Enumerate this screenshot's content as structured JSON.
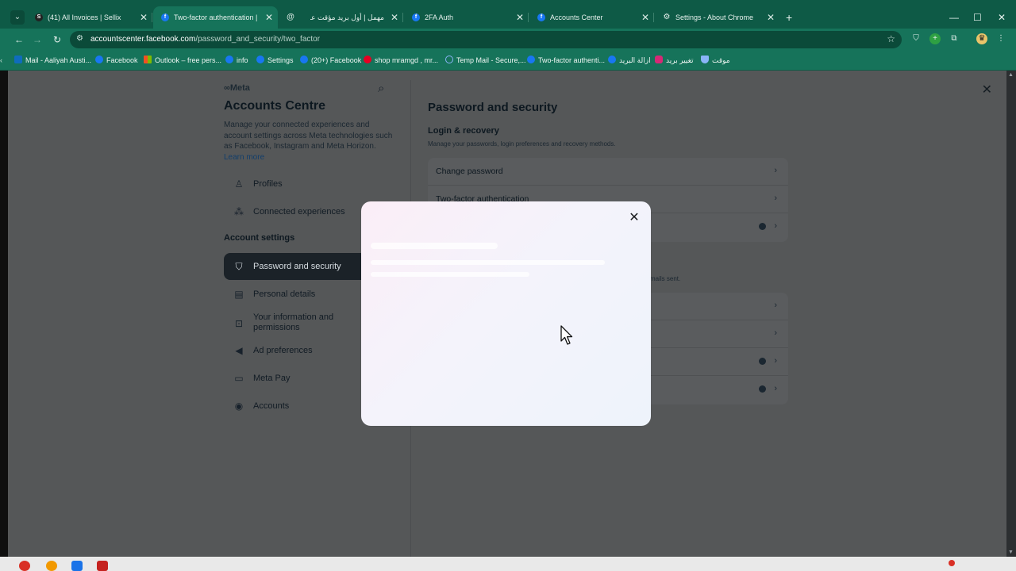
{
  "browser": {
    "tabs": [
      {
        "title": "(41) All Invoices | Sellix",
        "favicon": "S",
        "active": false
      },
      {
        "title": "Two-factor authentication | Acc",
        "favicon": "f",
        "active": true
      },
      {
        "title": "مهمل | أول بريد مؤقت عربي",
        "favicon": "@",
        "active": false
      },
      {
        "title": "2FA Auth",
        "favicon": "f",
        "active": false
      },
      {
        "title": "Accounts Center",
        "favicon": "f",
        "active": false
      },
      {
        "title": "Settings - About Chrome",
        "favicon": "gear",
        "active": false
      }
    ],
    "new_tab_label": "+",
    "url_domain": "accountscenter.facebook.com",
    "url_path": "/password_and_security/two_factor",
    "bookmarks": [
      {
        "label": "Mail - Aaliyah Austi...",
        "icon": "outlook"
      },
      {
        "label": "Facebook",
        "icon": "facebook"
      },
      {
        "label": "Outlook – free pers...",
        "icon": "microsoft"
      },
      {
        "label": "info",
        "icon": "facebook"
      },
      {
        "label": "Settings",
        "icon": "facebook"
      },
      {
        "label": "(20+) Facebook",
        "icon": "facebook"
      },
      {
        "label": "shop mramgd , mr...",
        "icon": "pinterest"
      },
      {
        "label": "Temp Mail - Secure,...",
        "icon": "tempmail"
      },
      {
        "label": "Two-factor authenti...",
        "icon": "facebook"
      },
      {
        "label": "ازالة البريد",
        "icon": "facebook"
      },
      {
        "label": "تغيير بريد",
        "icon": "instagram"
      },
      {
        "label": "موقت",
        "icon": "shield"
      }
    ]
  },
  "sidebar": {
    "brand": "∞Meta",
    "title": "Accounts Centre",
    "description": "Manage your connected experiences and account settings across Meta technologies such as Facebook, Instagram and Meta Horizon.",
    "learn_more": "Learn more",
    "top_items": [
      {
        "label": "Profiles",
        "icon": "person-icon"
      },
      {
        "label": "Connected experiences",
        "icon": "connected-icon"
      }
    ],
    "section_title": "Account settings",
    "settings_items": [
      {
        "label": "Password and security",
        "icon": "shield-icon",
        "active": true
      },
      {
        "label": "Personal details",
        "icon": "id-card-icon",
        "active": false
      },
      {
        "label": "Your information and permissions",
        "icon": "lock-doc-icon",
        "active": false
      },
      {
        "label": "Ad preferences",
        "icon": "megaphone-icon",
        "active": false
      },
      {
        "label": "Meta Pay",
        "icon": "card-icon",
        "active": false
      },
      {
        "label": "Accounts",
        "icon": "account-icon",
        "active": false
      }
    ]
  },
  "main": {
    "title": "Password and security",
    "login_recovery": {
      "heading": "Login & recovery",
      "description": "Manage your passwords, login preferences and recovery methods.",
      "rows": [
        {
          "label": "Change password"
        },
        {
          "label": "Two-factor authentication"
        },
        {
          "label": ""
        }
      ]
    },
    "security_checks_tail": "mails sent.",
    "second_rows": [
      {
        "label": ""
      },
      {
        "label": ""
      },
      {
        "label": ""
      },
      {
        "label": ""
      }
    ]
  },
  "modal": {
    "state": "loading",
    "close_label": "✕"
  },
  "colors": {
    "chrome_green": "#16735a",
    "overlay": "#555758",
    "active_nav": "#1b2228"
  }
}
